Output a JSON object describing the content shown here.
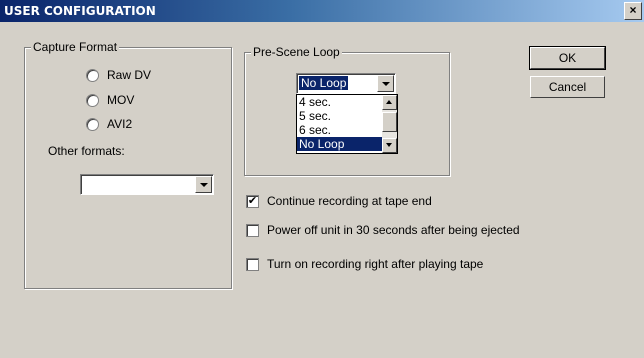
{
  "window": {
    "title": "USER CONFIGURATION",
    "close_glyph": "×"
  },
  "capture_format": {
    "legend": "Capture Format",
    "options": [
      {
        "label": "Raw DV"
      },
      {
        "label": "MOV"
      },
      {
        "label": "AVI2"
      }
    ],
    "other_formats_label": "Other formats:",
    "other_formats_value": ""
  },
  "pre_scene_loop": {
    "legend": "Pre-Scene Loop",
    "selected": "No Loop",
    "list_items": [
      "4 sec.",
      "5 sec.",
      "6 sec.",
      "No Loop"
    ]
  },
  "options": {
    "continue_recording": {
      "label": "Continue recording at tape end",
      "checked": true,
      "mark": "✔"
    },
    "power_off": {
      "label": "Power off unit in 30 seconds after being ejected",
      "checked": false,
      "mark": ""
    },
    "turn_on_recording": {
      "label": "Turn on recording right after playing tape",
      "checked": false,
      "mark": ""
    }
  },
  "buttons": {
    "ok": "OK",
    "cancel": "Cancel"
  }
}
